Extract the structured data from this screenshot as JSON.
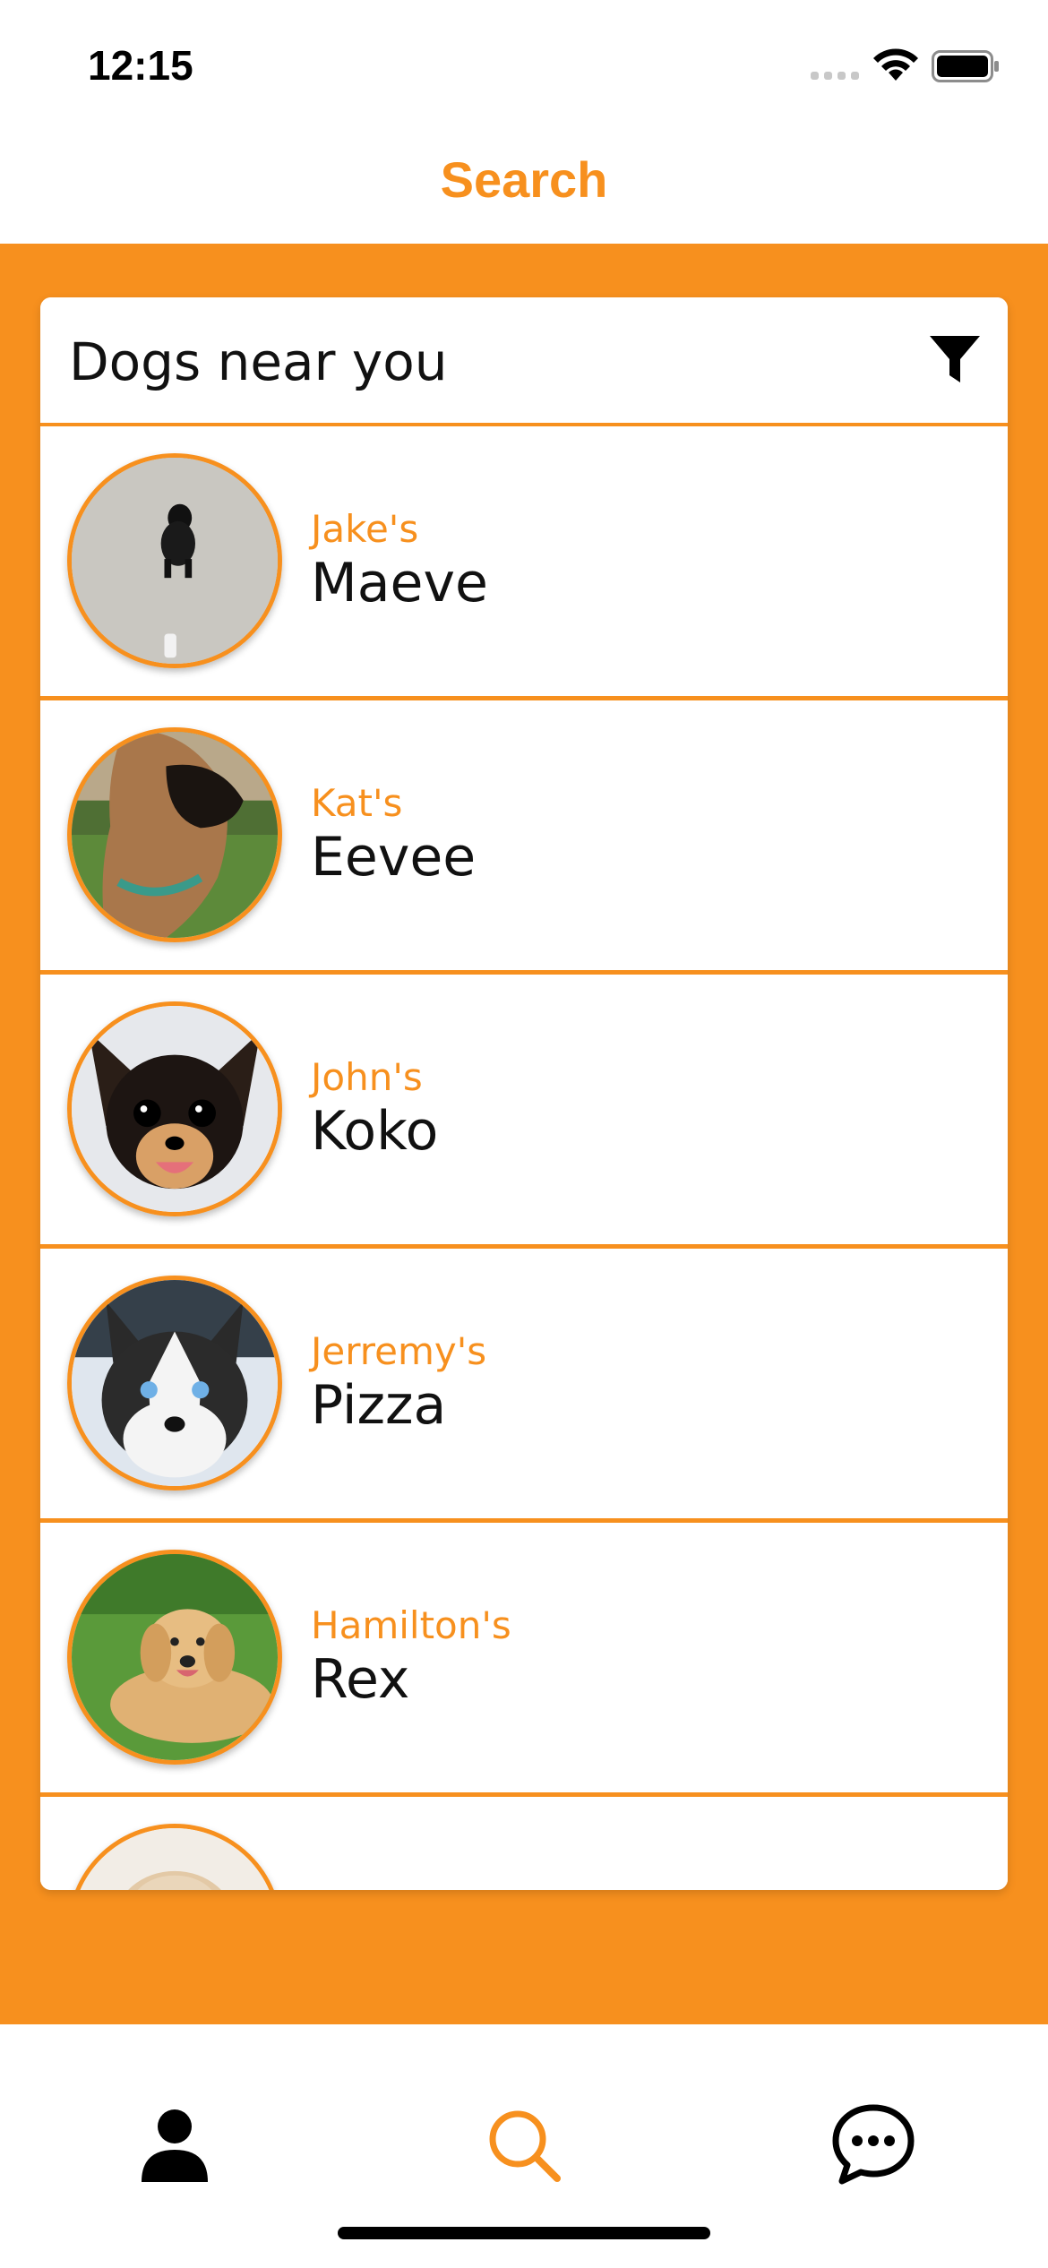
{
  "status_bar": {
    "time": "12:15"
  },
  "nav": {
    "title": "Search"
  },
  "section": {
    "title": "Dogs near you",
    "filter_icon": "filter-icon"
  },
  "dogs": [
    {
      "owner": "Jake's",
      "name": "Maeve"
    },
    {
      "owner": "Kat's",
      "name": "Eevee"
    },
    {
      "owner": "John's",
      "name": "Koko"
    },
    {
      "owner": "Jerremy's",
      "name": "Pizza"
    },
    {
      "owner": "Hamilton's",
      "name": "Rex"
    },
    {
      "owner": "",
      "name": ""
    }
  ],
  "tabs": [
    {
      "icon": "person-icon",
      "active": false
    },
    {
      "icon": "search-icon",
      "active": true
    },
    {
      "icon": "chat-icon",
      "active": false
    }
  ],
  "colors": {
    "accent": "#f7901e",
    "text": "#111111",
    "background": "#ffffff"
  }
}
